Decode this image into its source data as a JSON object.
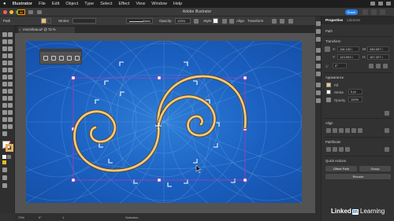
{
  "menubar": {
    "apple": "",
    "app_name": "Illustrator",
    "items": [
      "File",
      "Edit",
      "Object",
      "Type",
      "Select",
      "Effect",
      "View",
      "Window",
      "Help"
    ]
  },
  "titlebar": {
    "title": "Adobe Illustrator",
    "logo": "Ai",
    "share": "Share"
  },
  "controlbar": {
    "path": "Path",
    "stroke_label": "Stroke:",
    "brush": "Basic",
    "opacity_label": "Opacity:",
    "opacity_value": "100%",
    "style_label": "Style:",
    "align": "Align",
    "transform": "Transform"
  },
  "document": {
    "tab_title": "rAsAShow.ai* @ 73 % (RGB/Preview)",
    "close": "×"
  },
  "statusbar": {
    "zoom": "73%",
    "rotation": "0°",
    "page": "1",
    "tool": "Selection"
  },
  "properties": {
    "tab_properties": "Properties",
    "tab_libraries": "Libraries",
    "path_label": "Path",
    "transform_title": "Transform",
    "x_label": "X:",
    "x_value": "118.152 i",
    "w_label": "W:",
    "w_value": "280.057 i",
    "y_label": "Y:",
    "y_value": "143.903 i",
    "h_label": "H:",
    "h_value": "167.207 i",
    "angle_label": "△:",
    "angle_value": "0°",
    "appearance_title": "Appearance",
    "fill_label": "Fill",
    "stroke_label": "Stroke",
    "stroke_value": "0 pt",
    "opacity_label": "Opacity",
    "opacity_value": "100%",
    "align_title": "Align",
    "pathfinder_title": "Pathfinder",
    "quick_actions_title": "Quick Actions",
    "offset_path": "Offset Path",
    "group": "Group",
    "recolor": "Recolor"
  },
  "branding": {
    "linked": "Linked",
    "in": "in",
    "learning": "Learning"
  },
  "colors": {
    "accent": "#2680eb",
    "artboard": "#1a5fc0",
    "spiral": "#f2c97a",
    "selection": "#b23bb5",
    "linkedin": "#0a66c2"
  }
}
